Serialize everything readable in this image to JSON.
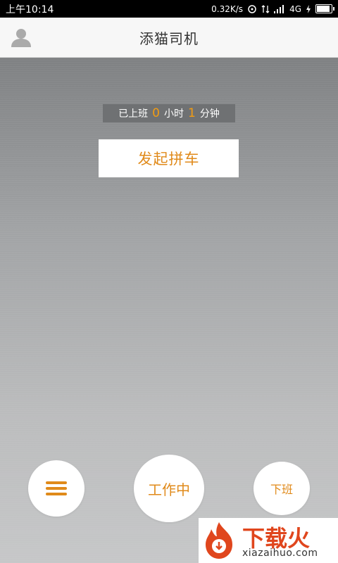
{
  "status_bar": {
    "time": "上午10:14",
    "speed": "0.32K/s",
    "network": "4G"
  },
  "header": {
    "title": "添猫司机"
  },
  "work_time": {
    "prefix": "已上班",
    "hours": "0",
    "hours_unit": "小时",
    "minutes": "1",
    "minutes_unit": "分钟"
  },
  "actions": {
    "start_carpool": "发起拼车",
    "working": "工作中",
    "off_duty": "下班"
  },
  "watermark": {
    "text": "下载火",
    "domain": "xiazaihuo.com"
  },
  "colors": {
    "accent": "#e08a1a",
    "watermark": "#e0461d"
  }
}
